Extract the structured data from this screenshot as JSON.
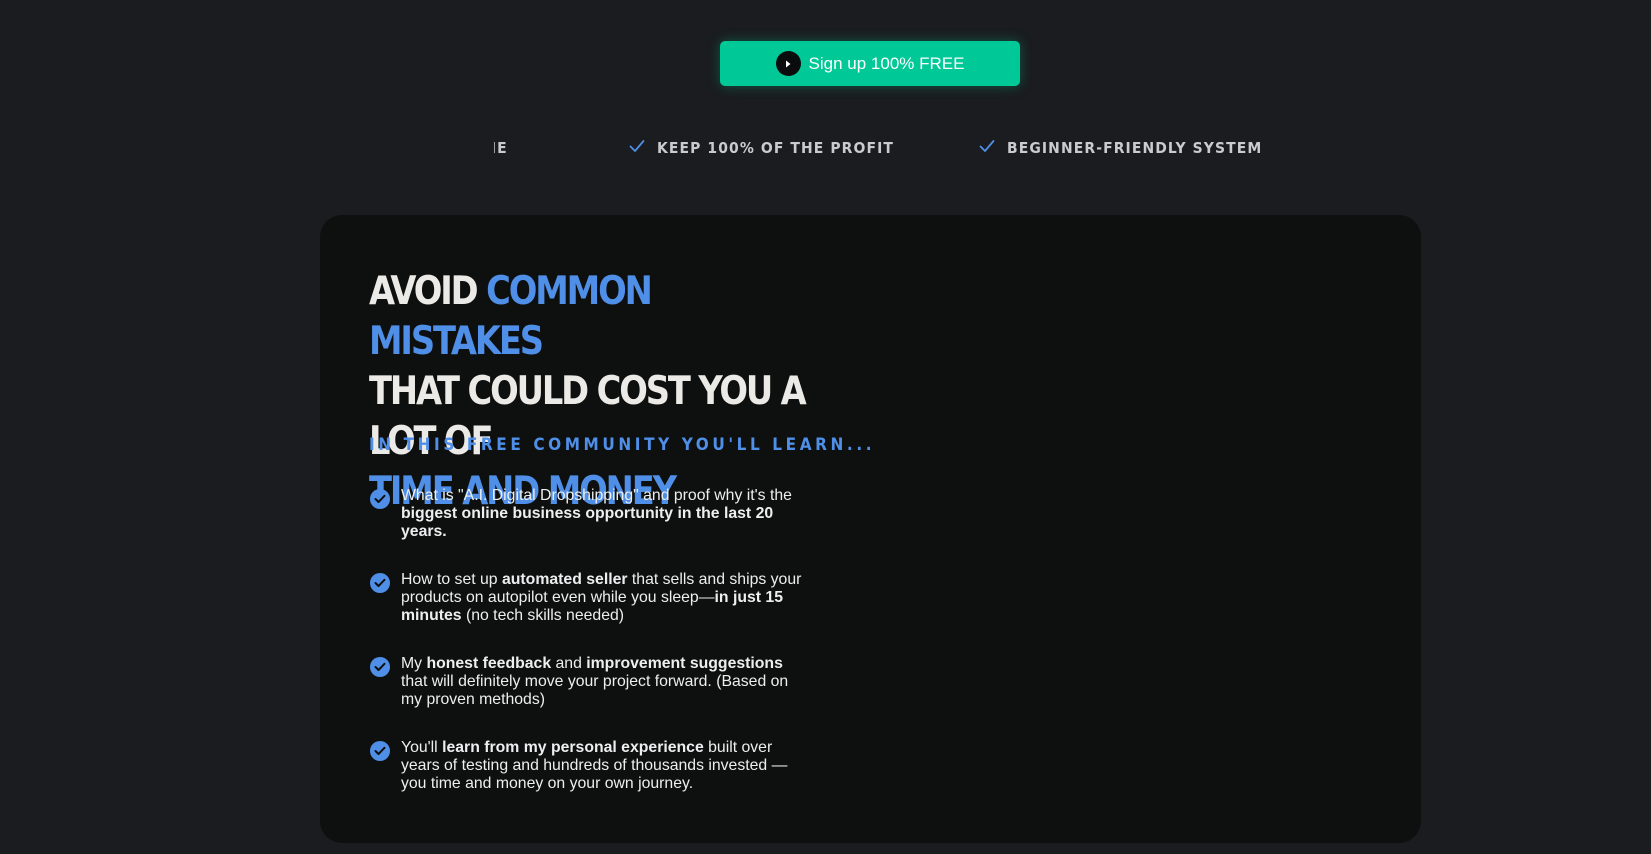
{
  "cta": {
    "label": "Sign up 100% FREE"
  },
  "ticker": {
    "items": [
      {
        "label": "YTIME"
      },
      {
        "label": "KEEP 100% OF THE PROFIT"
      },
      {
        "label": "BEGINNER-FRIENDLY SYSTEM"
      }
    ]
  },
  "headline": {
    "part1": "AVOID ",
    "part2": "COMMON MISTAKES",
    "part3": "THAT COULD COST YOU A LOT OF",
    "part4": "TIME AND MONEY"
  },
  "subhead": "IN THIS FREE COMMUNITY YOU'LL LEARN...",
  "benefits": [
    {
      "t1": "What is \"A.I. Digital Dropshipping\" and proof why it's the ",
      "b1": "biggest online business opportunity in the last 20 years."
    },
    {
      "t1": "How to set up ",
      "b1": "automated seller",
      "t2": " that sells and ships your products on autopilot even while you sleep—",
      "b2": "in just 15 minutes",
      "t3": " (no tech skills needed)"
    },
    {
      "t1": "My ",
      "b1": "honest feedback",
      "t2": " and ",
      "b2": "improvement suggestions",
      "t3": " that will definitely move your project forward. (Based on my proven methods)"
    },
    {
      "t1": "You'll ",
      "b1": "learn from my personal experience",
      "t2": " built over years of testing and hundreds of thousands invested — you time and money on your own journey."
    }
  ],
  "colors": {
    "page_bg": "#1a1c1f",
    "card_bg": "#0e100f",
    "accent_green": "#00c896",
    "accent_blue": "#4f8fe8",
    "text_light": "#eceeef"
  },
  "icons": {
    "cta": "play-circle-icon",
    "ticker": "checkmark-icon",
    "benefit": "check-circle-icon"
  }
}
